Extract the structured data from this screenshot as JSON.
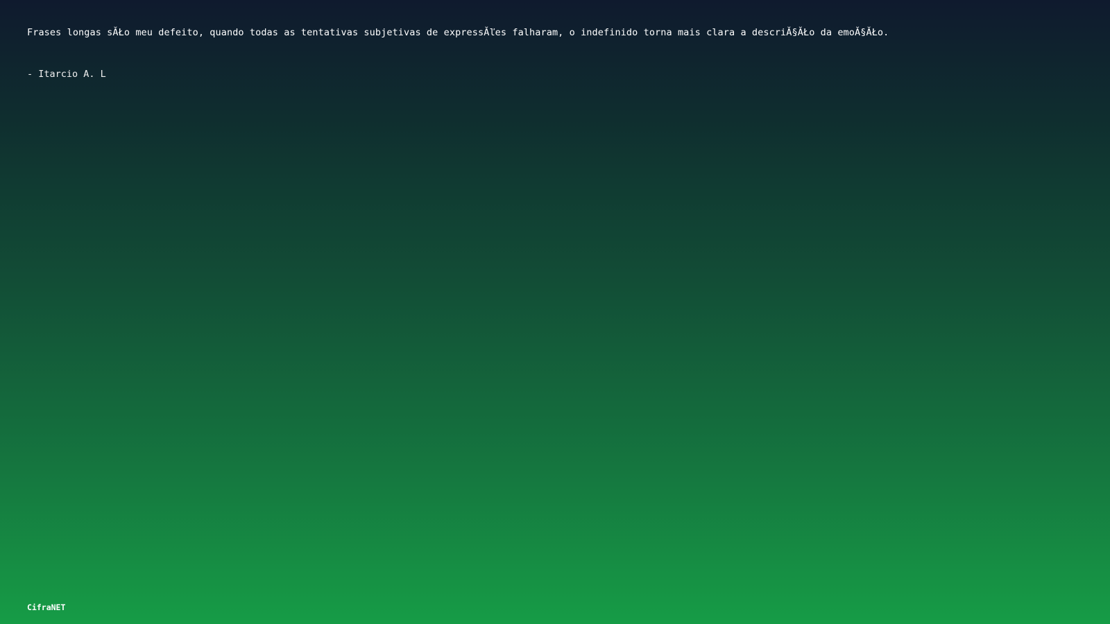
{
  "quote": {
    "text": "Frases longas sĂŁo meu defeito, quando todas as tentativas subjetivas de expressĂľes falharam, o indefinido torna mais clara a descriĂ§ĂŁo da emoĂ§ĂŁo.",
    "author": "- Itarcio A. L"
  },
  "footer": {
    "brand": "CifraNET"
  },
  "colors": {
    "background_top": "#0f1a2e",
    "background_bottom": "#169c46",
    "text": "#ffffff"
  }
}
